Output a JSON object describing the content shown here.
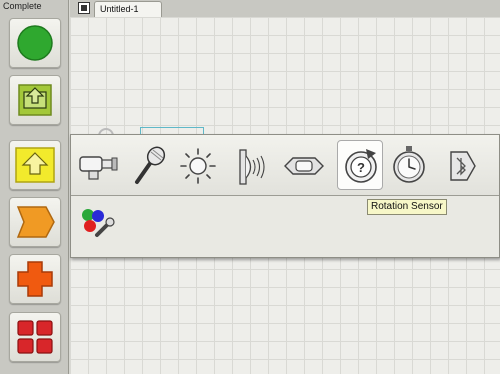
{
  "palette": {
    "title": "Complete",
    "items": [
      {
        "name": "start-block",
        "color": "#2fa82f"
      },
      {
        "name": "action-block",
        "color": "#a3c83a"
      },
      {
        "name": "sensor-block",
        "color": "#f2ea2c"
      },
      {
        "name": "flow-block",
        "color": "#f09a24"
      },
      {
        "name": "data-block",
        "color": "#f05a10"
      },
      {
        "name": "advanced-block",
        "color": "#d8262a"
      }
    ]
  },
  "document": {
    "tab_label": "Untitled-1"
  },
  "subpalette": {
    "sensors": [
      {
        "name": "touch-sensor-icon"
      },
      {
        "name": "sound-sensor-icon"
      },
      {
        "name": "light-sensor-icon"
      },
      {
        "name": "ultrasonic-sensor-icon"
      },
      {
        "name": "nxt-buttons-icon"
      },
      {
        "name": "rotation-sensor-icon",
        "selected": true
      },
      {
        "name": "timer-icon"
      },
      {
        "name": "receive-message-icon"
      }
    ],
    "tooltip": "Rotation Sensor",
    "row2": [
      {
        "name": "color-sensor-icon"
      }
    ]
  }
}
